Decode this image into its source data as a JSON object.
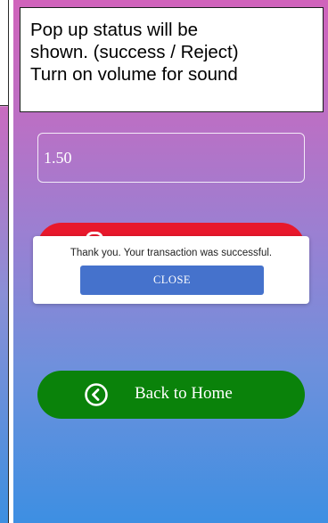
{
  "note": {
    "line1": "Pop up status will be",
    "line2": "shown. (success / Reject)",
    "line3": "Turn on volume for sound"
  },
  "form": {
    "amount_value": "1.50"
  },
  "popup": {
    "message": "Thank you. Your transaction was successful.",
    "close_label": "CLOSE"
  },
  "home_button": {
    "label": "Back to Home",
    "icon": "chevron-left-circle-icon"
  },
  "colors": {
    "gradient_top": "#d063bb",
    "gradient_bottom": "#3d8fe2",
    "red_button": "#e8182c",
    "close_button": "#4572cc",
    "home_button": "#0a820a"
  }
}
